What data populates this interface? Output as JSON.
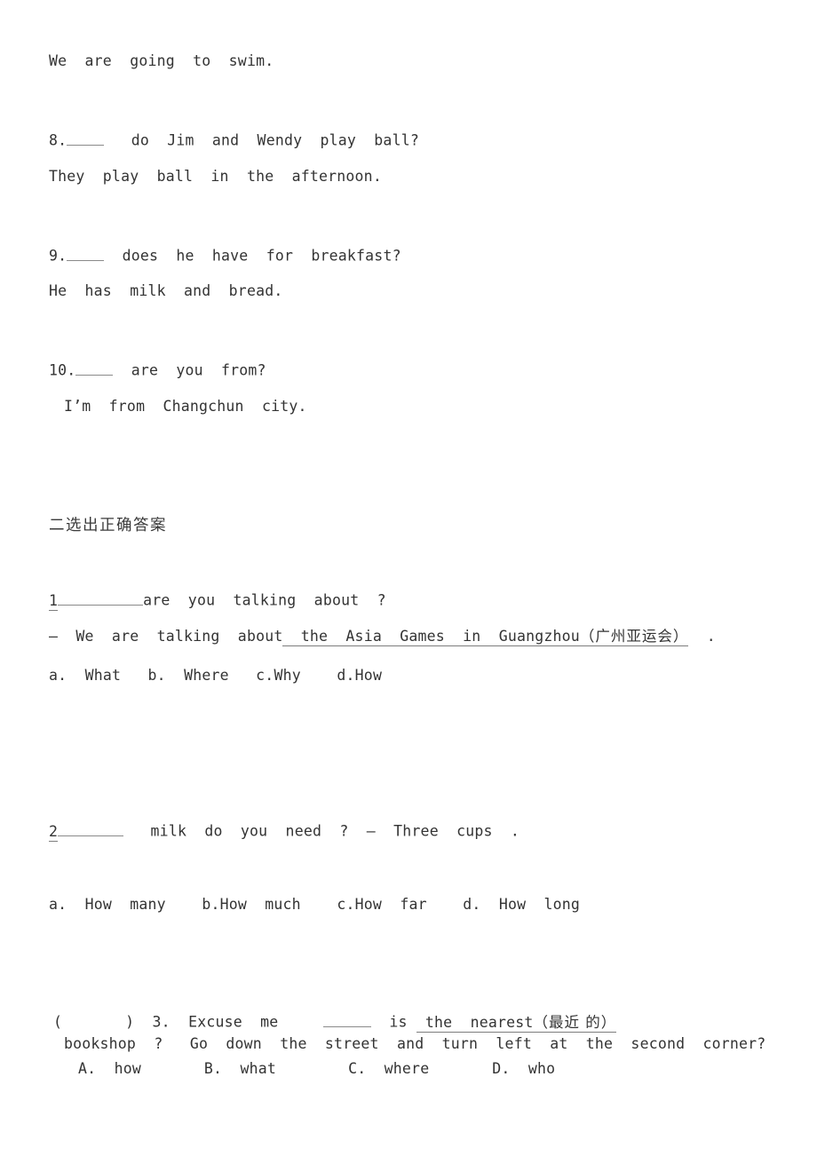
{
  "document": {
    "type": "worksheet",
    "language_primary": "en",
    "language_annotations": "zh",
    "background_color": "#ffffff",
    "text_color": "#333333",
    "rule_color": "#8a8a8a"
  },
  "section_one_tail": {
    "q7_answer": "We  are  going  to  swim.",
    "q8": {
      "number": "8.",
      "blank": "",
      "question_text": "do  Jim  and  Wendy  play  ball?",
      "answer_text": "They  play  ball  in  the  afternoon."
    },
    "q9": {
      "number": "9.",
      "blank": "",
      "question_text": "does  he  have  for  breakfast?",
      "answer_text": "He  has  milk  and  bread."
    },
    "q10": {
      "number": "10.",
      "blank": "",
      "question_text": "are  you  from?",
      "answer_text": "I’m  from  Changchun  city."
    }
  },
  "section_two": {
    "heading": "二选出正确答案",
    "questions": [
      {
        "number": "1",
        "stem_after_blank": "are  you  talking  about  ?",
        "answer_prefix": "–  We  are  talking  about",
        "answer_underlined_en": "  the  Asia  Games  in  Guangzhou",
        "answer_underlined_cn": "（广州亚运会）",
        "answer_suffix": ".",
        "options": [
          {
            "letter": "a.",
            "text": "What"
          },
          {
            "letter": "b.",
            "text": "Where"
          },
          {
            "letter": "c.",
            "text": "Why"
          },
          {
            "letter": "d.",
            "text": "How"
          }
        ]
      },
      {
        "number": "2",
        "stem_after_blank": "milk  do  you  need  ?  –  Three  cups  .",
        "options": [
          {
            "letter": "a.",
            "text": "How  many"
          },
          {
            "letter": "b.",
            "text": "How  much"
          },
          {
            "letter": "c.",
            "text": "How  far"
          },
          {
            "letter": "d.",
            "text": "How  long"
          }
        ]
      },
      {
        "bracket_open": "(",
        "bracket_close": ")",
        "number": "3.",
        "stem_before_blank": "Excuse  me",
        "stem_after_blank": "is",
        "underlined_en": " the  nearest",
        "underlined_cn": "（最近 的）",
        "line2": "bookshop  ?   Go  down  the  street  and  turn  left  at  the  second  corner?",
        "options": [
          {
            "letter": "A.",
            "text": "how"
          },
          {
            "letter": "B.",
            "text": "what"
          },
          {
            "letter": "C.",
            "text": "where"
          },
          {
            "letter": "D.",
            "text": "who"
          }
        ]
      }
    ]
  }
}
